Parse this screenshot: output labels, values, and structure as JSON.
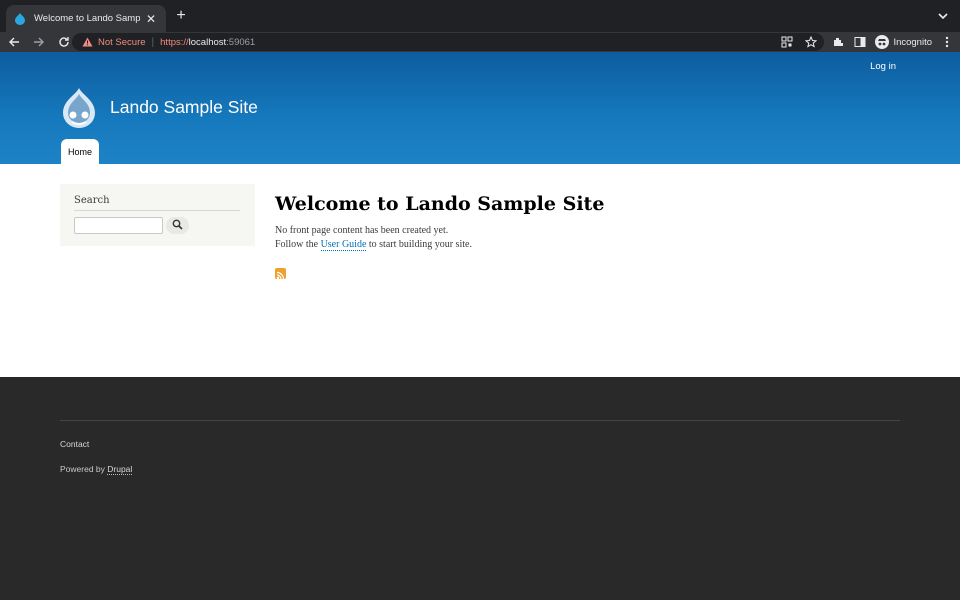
{
  "browser": {
    "tab_title": "Welcome to Lando Sample Site",
    "new_tab": "+",
    "security_label": "Not Secure",
    "url_scheme": "https://",
    "url_host": "localhost",
    "url_port": ":59061",
    "profile_label": "Incognito"
  },
  "header": {
    "login": "Log in",
    "site_name": "Lando Sample Site",
    "nav": [
      {
        "label": "Home"
      }
    ]
  },
  "sidebar": {
    "search_title": "Search",
    "search_value": ""
  },
  "main": {
    "title": "Welcome to Lando Sample Site",
    "line1": "No front page content has been created yet.",
    "line2_prefix": "Follow the ",
    "line2_link": "User Guide",
    "line2_suffix": " to start building your site."
  },
  "footer": {
    "contact": "Contact",
    "powered_prefix": "Powered by ",
    "powered_link": "Drupal"
  },
  "colors": {
    "header_blue": "#1679bd",
    "link_blue": "#0071b3",
    "footer_bg": "#292929",
    "warning_red": "#f28b82"
  },
  "icons": [
    "drupal-favicon-icon",
    "close-icon",
    "back-icon",
    "forward-icon",
    "reload-icon",
    "warning-icon",
    "qr-code-icon",
    "star-icon",
    "extensions-icon",
    "side-panel-icon",
    "incognito-icon",
    "menu-icon",
    "search-icon",
    "rss-feed-icon",
    "drupal-logo-icon"
  ]
}
